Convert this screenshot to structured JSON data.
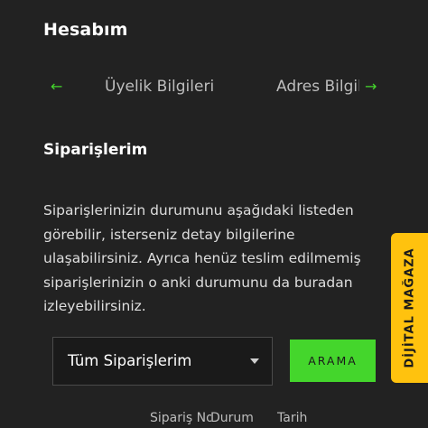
{
  "page": {
    "title": "Hesabım"
  },
  "tabs": {
    "prev_icon": "arrow-left-icon",
    "next_icon": "arrow-right-icon",
    "items": [
      {
        "label": "Üyelik Bilgileri"
      },
      {
        "label": "Adres Bilgileri"
      }
    ]
  },
  "orders": {
    "title": "Siparişlerim",
    "description": "Siparişlerinizin durumunu aşağıdaki listeden görebilir, isterseniz detay bilgilerine ulaşabilirsiniz. Ayrıca henüz teslim edilmemiş siparişlerinizin o anki durumunu da buradan izleyebilirsiniz.",
    "filter": {
      "selected": "Tüm Siparişlerim"
    },
    "search_label": "ARAMA",
    "columns": [
      "Sipariş No",
      "Durum",
      "Tarih"
    ]
  },
  "side_tab": {
    "label": "DİJİTAL MAĞAZA"
  },
  "colors": {
    "background": "#222222",
    "accent": "#44d62c",
    "side_tab": "#ffc20e"
  }
}
